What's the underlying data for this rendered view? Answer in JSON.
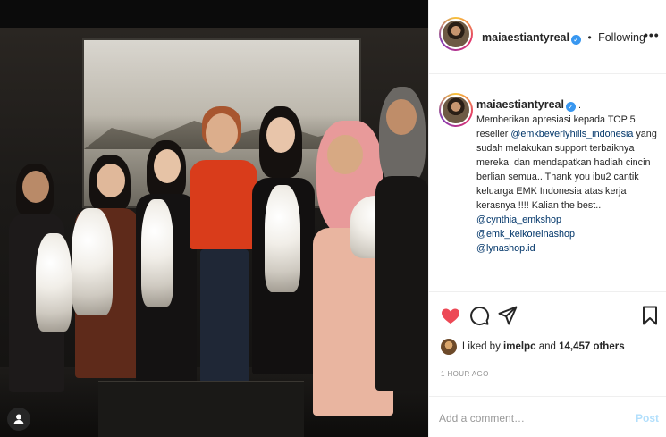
{
  "post": {
    "username": "maiaestiantyreal",
    "follow_separator": "•",
    "follow_label": "Following",
    "more_glyph": "•••"
  },
  "caption": {
    "username": "maiaestiantyreal",
    "after_user": ".",
    "line1": "Memberikan apresiasi kepada TOP 5 reseller ",
    "mention1": "@emkbeverlyhills_indonesia",
    "line2": " yang sudah melakukan support terbaiknya mereka, dan mendapatkan hadiah cincin berlian semua.. Thank you ibu2 cantik keluarga EMK Indonesia atas kerja kerasnya !!!! Kalian the best.. ",
    "mention2": "@cynthia_emkshop",
    "mention3": "@emk_keikoreinashop",
    "mention4": "@lynashop.id"
  },
  "likes": {
    "prefix": "Liked by ",
    "user": "imelpc",
    "middle": " and ",
    "count": "14,457 others"
  },
  "timestamp": "1 HOUR AGO",
  "comment_box": {
    "placeholder": "Add a comment…",
    "post_label": "Post"
  },
  "colors": {
    "like_red": "#ed4956",
    "link_blue": "#003569",
    "verified_blue": "#3897f0",
    "post_disabled": "#b2dffc"
  },
  "icons": [
    "heart-icon",
    "comment-icon",
    "share-icon",
    "bookmark-icon",
    "verified-badge-icon",
    "user-tag-icon",
    "more-options-icon"
  ]
}
